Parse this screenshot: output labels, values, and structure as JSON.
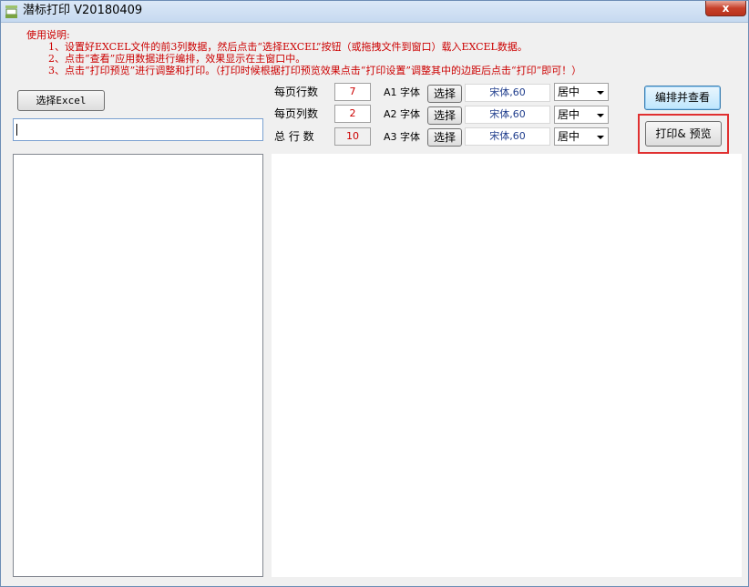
{
  "window": {
    "title": "潜标打印 V20180409",
    "close_label": "x"
  },
  "instructions": {
    "heading": "使用说明:",
    "lines": [
      "1、设置好EXCEL文件的前3列数据，然后点击“选择EXCEL”按钮（或拖拽文件到窗口）载入EXCEL数据。",
      "2、点击“查看”应用数据进行编排，效果显示在主窗口中。",
      "3、点击“打印预览”进行调整和打印。（打印时候根据打印预览效果点击“打印设置”调整其中的边距后点击“打印”即可！）"
    ]
  },
  "left": {
    "select_excel_label": "选择Excel",
    "path_value": ""
  },
  "settings": {
    "rows_per_page_label": "每页行数",
    "rows_per_page_value": "7",
    "cols_per_page_label": "每页列数",
    "cols_per_page_value": "2",
    "total_rows_label": "总 行 数",
    "total_rows_value": "10"
  },
  "fonts": [
    {
      "label": "A1 字体",
      "choose_label": "选择",
      "font_value": "宋体,60",
      "align_value": "居中"
    },
    {
      "label": "A2 字体",
      "choose_label": "选择",
      "font_value": "宋体,60",
      "align_value": "居中"
    },
    {
      "label": "A3 字体",
      "choose_label": "选择",
      "font_value": "宋体,60",
      "align_value": "居中"
    }
  ],
  "actions": {
    "compose_label": "编排并查看",
    "print_label": "打印& 预览"
  },
  "colors": {
    "instructions": "#cc0000",
    "highlight": "#e03030",
    "font_value": "#1e3c8c"
  }
}
